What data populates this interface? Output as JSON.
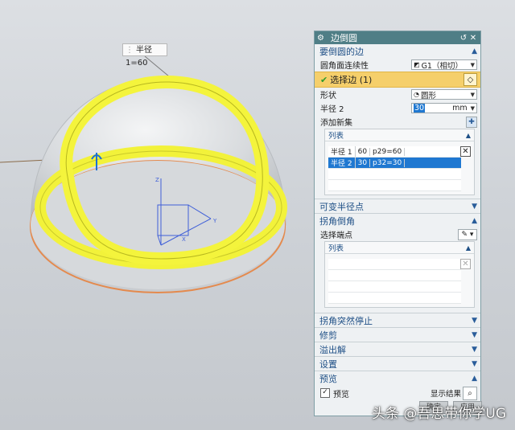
{
  "viewport": {
    "dimension_label": "半径 1=60",
    "axis_labels": {
      "x": "X",
      "y": "Y",
      "z": "Z"
    }
  },
  "dialog": {
    "title": "边倒圆",
    "sections": {
      "edge": {
        "title": "要倒圆的边",
        "continuity_label": "圆角面连续性",
        "continuity_value": "G1（相切）",
        "select_edge_label": "选择边 (1)",
        "shape_label": "形状",
        "shape_value": "圆形",
        "radius_label": "半径 2",
        "radius_value": "30",
        "radius_unit": "mm",
        "add_set_label": "添加新集",
        "list_title": "列表",
        "list_rows": [
          {
            "name": "半径 1",
            "value": "60",
            "param": "p29=60",
            "selected": false
          },
          {
            "name": "半径 2",
            "value": "30",
            "param": "p32=30",
            "selected": true
          }
        ]
      },
      "variable_radius": {
        "title": "可变半径点"
      },
      "corner_setback": {
        "title": "拐角倒角",
        "select_endpoint_label": "选择端点",
        "list_title": "列表"
      },
      "corner_stop": {
        "title": "拐角突然停止"
      },
      "trim": {
        "title": "修剪"
      },
      "overflow": {
        "title": "溢出解"
      },
      "settings": {
        "title": "设置"
      },
      "preview": {
        "title": "预览",
        "preview_checkbox_label": "预览",
        "show_result_label": "显示结果"
      }
    },
    "bottom_buttons": [
      "确定",
      "应用",
      "取消"
    ]
  },
  "watermark": "头条 @吾思带你学UG",
  "colors": {
    "title_bar": "#4f7e86",
    "section_text": "#1e4f86",
    "selection_band": "#f5cf6b",
    "selected_row": "#1f78d1",
    "fillet_yellow": "#f2f23a"
  }
}
